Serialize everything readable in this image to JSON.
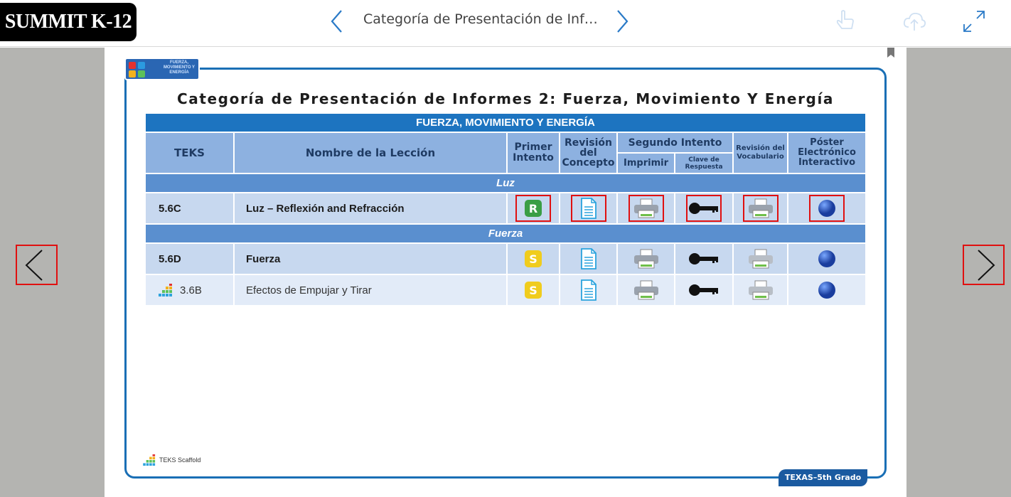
{
  "app": {
    "logo_text": "SUMMIT K-12"
  },
  "nav": {
    "title": "Categoría de Presentación de Inf…"
  },
  "icons": {
    "prev": "chevron-left-icon",
    "next": "chevron-right-icon",
    "hand": "hand-pointer-icon",
    "cloud": "cloud-upload-icon",
    "expand": "expand-icon",
    "bookmark": "bookmark-icon"
  },
  "badge": {
    "text": "FUERZA, MOVIMIENTO Y ENERGÍA"
  },
  "document": {
    "title": "Categoría de Presentación de Informes 2: Fuerza, Movimiento Y Energía",
    "band": "FUERZA, MOVIMIENTO Y ENERGÍA",
    "headers": {
      "teks": "TEKS",
      "lesson": "Nombre de la Lección",
      "first": "Primer Intento",
      "concept": "Revisión del Concepto",
      "second": "Segundo Intento",
      "print": "Imprimir",
      "key": "Clave de Respuesta",
      "vocab": "Revisión del Vocabulario",
      "poster": "Póster Electrónico Interactivo"
    },
    "sections": {
      "luz": "Luz",
      "fuerza": "Fuerza"
    },
    "rows": [
      {
        "teks": "5.6C",
        "lesson": "Luz – Reflexión and Refracción",
        "first_badge": "R"
      },
      {
        "teks": "5.6D",
        "lesson": "Fuerza",
        "first_badge": "S"
      },
      {
        "teks": "3.6B",
        "lesson": "Efectos de Empujar y Tirar",
        "first_badge": "S"
      }
    ],
    "legend": "TEKS Scaffold",
    "grade_tag": "TEXAS–5th Grado"
  },
  "colors": {
    "accent": "#1d74c0",
    "header": "#8db1e0",
    "row": "#c7d8ef",
    "row_alt": "#e2ebf8",
    "highlight": "#e01010"
  }
}
